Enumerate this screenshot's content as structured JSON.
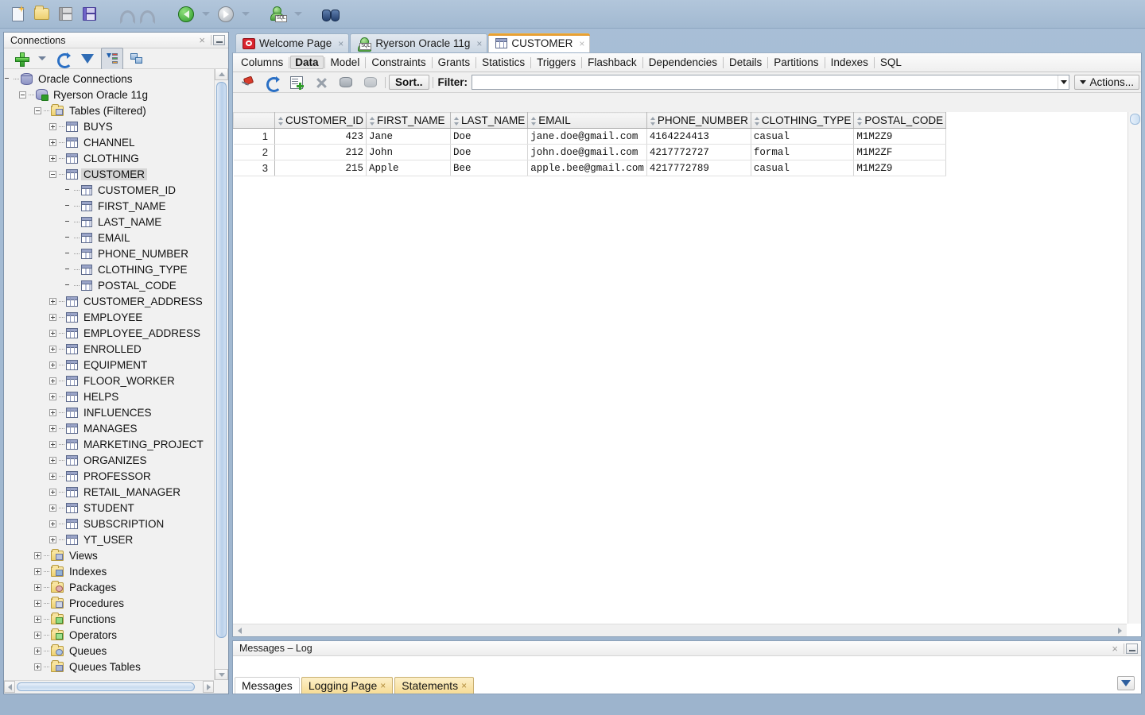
{
  "toolbar": {
    "buttons": [
      {
        "name": "new-file-icon",
        "label": "New"
      },
      {
        "name": "open-file-icon",
        "label": "Open"
      },
      {
        "name": "save-icon",
        "label": "Save"
      },
      {
        "name": "save-all-icon",
        "label": "Save All"
      },
      {
        "name": "undo-icon",
        "label": "Undo"
      },
      {
        "name": "redo-icon",
        "label": "Redo"
      },
      {
        "name": "back-icon",
        "label": "Back"
      },
      {
        "name": "forward-icon",
        "label": "Forward"
      },
      {
        "name": "sql-worksheet-icon",
        "label": "SQL Worksheet"
      },
      {
        "name": "find-icon",
        "label": "Find"
      }
    ],
    "sql_badge": "SQL"
  },
  "connections": {
    "title": "Connections",
    "close_label": "×",
    "tools": [
      {
        "name": "new-connection-icon",
        "label": "New Connection"
      },
      {
        "name": "refresh-icon",
        "label": "Refresh"
      },
      {
        "name": "filter-icon",
        "label": "Filter"
      },
      {
        "name": "sort-columns-icon",
        "label": "Sort Columns"
      },
      {
        "name": "collapse-all-icon",
        "label": "Collapse All"
      }
    ],
    "tree": [
      {
        "label": "Oracle Connections",
        "depth": 0,
        "icon": "db",
        "state": "none"
      },
      {
        "label": "Ryerson Oracle 11g",
        "depth": 1,
        "icon": "dbconn",
        "state": "minus"
      },
      {
        "label": "Tables (Filtered)",
        "depth": 2,
        "icon": "folder",
        "state": "minus"
      },
      {
        "label": "BUYS",
        "depth": 3,
        "icon": "table",
        "state": "plus"
      },
      {
        "label": "CHANNEL",
        "depth": 3,
        "icon": "table",
        "state": "plus"
      },
      {
        "label": "CLOTHING",
        "depth": 3,
        "icon": "table",
        "state": "plus"
      },
      {
        "label": "CUSTOMER",
        "depth": 3,
        "icon": "table",
        "state": "minus",
        "selected": true
      },
      {
        "label": "CUSTOMER_ID",
        "depth": 4,
        "icon": "column",
        "state": "none"
      },
      {
        "label": "FIRST_NAME",
        "depth": 4,
        "icon": "column",
        "state": "none"
      },
      {
        "label": "LAST_NAME",
        "depth": 4,
        "icon": "column",
        "state": "none"
      },
      {
        "label": "EMAIL",
        "depth": 4,
        "icon": "column",
        "state": "none"
      },
      {
        "label": "PHONE_NUMBER",
        "depth": 4,
        "icon": "column",
        "state": "none"
      },
      {
        "label": "CLOTHING_TYPE",
        "depth": 4,
        "icon": "column",
        "state": "none"
      },
      {
        "label": "POSTAL_CODE",
        "depth": 4,
        "icon": "column",
        "state": "none"
      },
      {
        "label": "CUSTOMER_ADDRESS",
        "depth": 3,
        "icon": "table",
        "state": "plus"
      },
      {
        "label": "EMPLOYEE",
        "depth": 3,
        "icon": "table",
        "state": "plus"
      },
      {
        "label": "EMPLOYEE_ADDRESS",
        "depth": 3,
        "icon": "table",
        "state": "plus"
      },
      {
        "label": "ENROLLED",
        "depth": 3,
        "icon": "table",
        "state": "plus"
      },
      {
        "label": "EQUIPMENT",
        "depth": 3,
        "icon": "table",
        "state": "plus"
      },
      {
        "label": "FLOOR_WORKER",
        "depth": 3,
        "icon": "table",
        "state": "plus"
      },
      {
        "label": "HELPS",
        "depth": 3,
        "icon": "table",
        "state": "plus"
      },
      {
        "label": "INFLUENCES",
        "depth": 3,
        "icon": "table",
        "state": "plus"
      },
      {
        "label": "MANAGES",
        "depth": 3,
        "icon": "table",
        "state": "plus"
      },
      {
        "label": "MARKETING_PROJECT",
        "depth": 3,
        "icon": "table",
        "state": "plus"
      },
      {
        "label": "ORGANIZES",
        "depth": 3,
        "icon": "table",
        "state": "plus"
      },
      {
        "label": "PROFESSOR",
        "depth": 3,
        "icon": "table",
        "state": "plus"
      },
      {
        "label": "RETAIL_MANAGER",
        "depth": 3,
        "icon": "table",
        "state": "plus"
      },
      {
        "label": "STUDENT",
        "depth": 3,
        "icon": "table",
        "state": "plus"
      },
      {
        "label": "SUBSCRIPTION",
        "depth": 3,
        "icon": "table",
        "state": "plus"
      },
      {
        "label": "YT_USER",
        "depth": 3,
        "icon": "table",
        "state": "plus"
      },
      {
        "label": "Views",
        "depth": 2,
        "icon": "folder-views",
        "state": "plus"
      },
      {
        "label": "Indexes",
        "depth": 2,
        "icon": "folder-indexes",
        "state": "plus"
      },
      {
        "label": "Packages",
        "depth": 2,
        "icon": "folder-packages",
        "state": "plus"
      },
      {
        "label": "Procedures",
        "depth": 2,
        "icon": "folder-procedures",
        "state": "plus"
      },
      {
        "label": "Functions",
        "depth": 2,
        "icon": "folder-functions",
        "state": "plus"
      },
      {
        "label": "Operators",
        "depth": 2,
        "icon": "folder-operators",
        "state": "plus"
      },
      {
        "label": "Queues",
        "depth": 2,
        "icon": "folder-queues",
        "state": "plus"
      },
      {
        "label": "Queues Tables",
        "depth": 2,
        "icon": "folder-queue-tables",
        "state": "plus"
      }
    ]
  },
  "editor": {
    "tabs": [
      {
        "label": "Welcome Page",
        "icon": "oracle-icon",
        "active": false,
        "close": "×"
      },
      {
        "label": "Ryerson Oracle 11g",
        "icon": "sql-connection-icon",
        "active": false,
        "close": "×"
      },
      {
        "label": "CUSTOMER",
        "icon": "table-icon",
        "active": true,
        "close": "×"
      }
    ],
    "subtabs": [
      {
        "label": "Columns",
        "active": false
      },
      {
        "label": "Data",
        "active": true
      },
      {
        "label": "Model",
        "active": false
      },
      {
        "label": "Constraints",
        "active": false
      },
      {
        "label": "Grants",
        "active": false
      },
      {
        "label": "Statistics",
        "active": false
      },
      {
        "label": "Triggers",
        "active": false
      },
      {
        "label": "Flashback",
        "active": false
      },
      {
        "label": "Dependencies",
        "active": false
      },
      {
        "label": "Details",
        "active": false
      },
      {
        "label": "Partitions",
        "active": false
      },
      {
        "label": "Indexes",
        "active": false
      },
      {
        "label": "SQL",
        "active": false
      }
    ],
    "grid_toolbar": {
      "icons": [
        {
          "name": "pin-icon",
          "label": "Freeze"
        },
        {
          "name": "refresh-data-icon",
          "label": "Refresh"
        },
        {
          "name": "insert-row-icon",
          "label": "Insert Row"
        },
        {
          "name": "delete-row-icon",
          "label": "Delete Row"
        },
        {
          "name": "commit-icon",
          "label": "Commit"
        },
        {
          "name": "rollback-icon",
          "label": "Rollback"
        }
      ],
      "sort_label": "Sort..",
      "filter_label": "Filter:",
      "filter_value": "",
      "filter_placeholder": "",
      "actions_label": "Actions..."
    }
  },
  "chart_data": {
    "type": "table",
    "title": "CUSTOMER",
    "columns": [
      "CUSTOMER_ID",
      "FIRST_NAME",
      "LAST_NAME",
      "EMAIL",
      "PHONE_NUMBER",
      "CLOTHING_TYPE",
      "POSTAL_CODE"
    ],
    "row_numbers": [
      "1",
      "2",
      "3"
    ],
    "rows": [
      [
        "423",
        "Jane",
        "Doe",
        "jane.doe@gmail.com",
        "4164224413",
        "casual",
        "M1M2Z9"
      ],
      [
        "212",
        "John",
        "Doe",
        "john.doe@gmail.com",
        "4217772727",
        "formal",
        "M1M2ZF"
      ],
      [
        "215",
        "Apple",
        "Bee",
        "apple.bee@gmail.com",
        "4217772789",
        "casual",
        "M1M2Z9"
      ]
    ]
  },
  "log": {
    "title": "Messages – Log",
    "close_label": "×",
    "tabs": [
      {
        "label": "Messages",
        "active": true,
        "close": ""
      },
      {
        "label": "Logging Page",
        "active": false,
        "close": "×"
      },
      {
        "label": "Statements",
        "active": false,
        "close": "×"
      }
    ]
  },
  "colors": {
    "chrome": "#a2b9d1",
    "panel": "#f1f1f1",
    "active_tab_accent": "#f3b23c",
    "log_tab": "#f6dc96"
  }
}
